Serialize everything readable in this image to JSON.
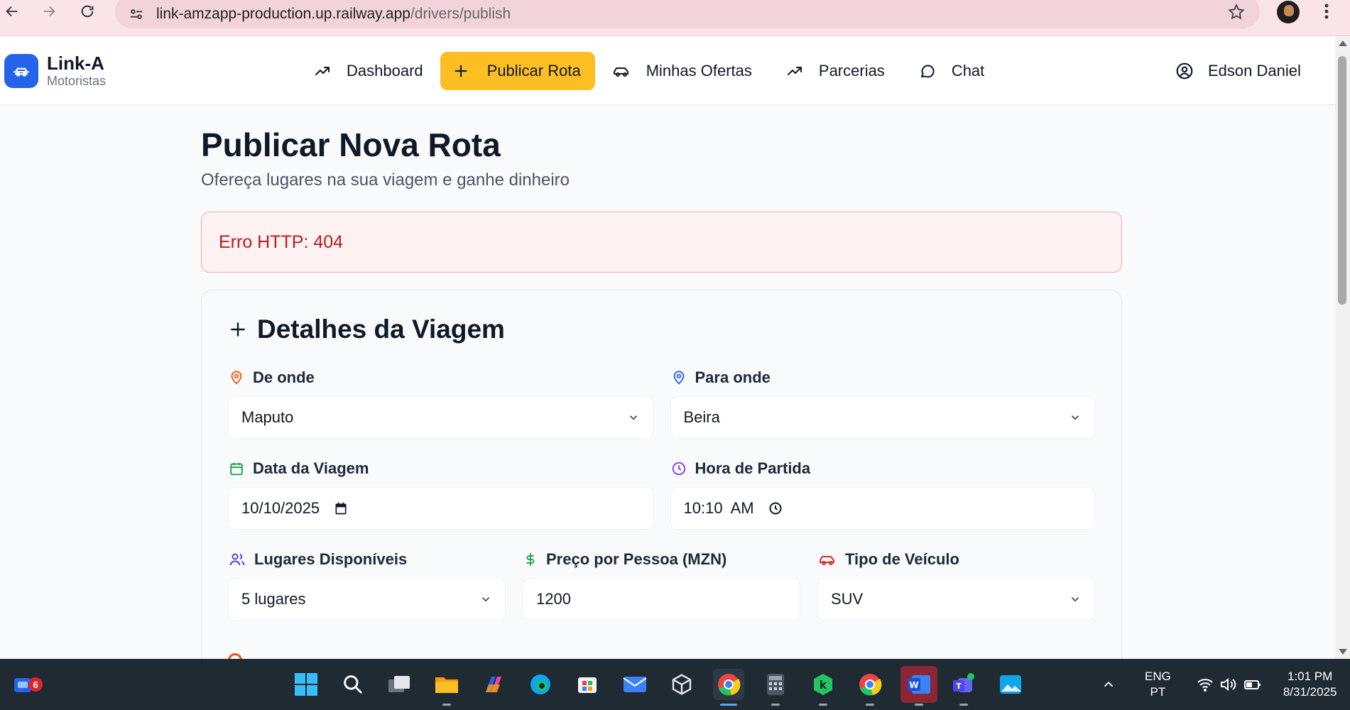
{
  "browser": {
    "url_host": "link-amzapp-production.up.railway.app",
    "url_path": "/drivers/publish"
  },
  "brand": {
    "name": "Link-A",
    "subtitle": "Motoristas"
  },
  "nav": {
    "items": [
      {
        "label": "Dashboard",
        "icon": "trending-up-icon",
        "active": false
      },
      {
        "label": "Publicar Rota",
        "icon": "plus-icon",
        "active": true
      },
      {
        "label": "Minhas Ofertas",
        "icon": "car-icon",
        "active": false
      },
      {
        "label": "Parcerias",
        "icon": "trending-up-icon",
        "active": false
      },
      {
        "label": "Chat",
        "icon": "chat-bubble-icon",
        "active": false
      }
    ]
  },
  "user": {
    "name": "Edson Daniel"
  },
  "page": {
    "title": "Publicar Nova Rota",
    "subtitle": "Ofereça lugares na sua viagem e ganhe dinheiro"
  },
  "alert": {
    "message": "Erro HTTP: 404"
  },
  "form": {
    "title": "Detalhes da Viagem",
    "from": {
      "label": "De onde",
      "value": "Maputo",
      "icon_color": "#ea580c"
    },
    "to": {
      "label": "Para onde",
      "value": "Beira",
      "icon_color": "#2563eb"
    },
    "date": {
      "label": "Data da Viagem",
      "value": "10/10/2025",
      "icon_color": "#16a34a"
    },
    "time": {
      "label": "Hora de Partida",
      "value": "10:10  AM",
      "icon_color": "#9333ea"
    },
    "seats": {
      "label": "Lugares Disponíveis",
      "value": "5 lugares",
      "icon_color": "#4f46e5"
    },
    "price": {
      "label": "Preço por Pessoa (MZN)",
      "value": "1200",
      "icon_color": "#16a34a"
    },
    "vehicle": {
      "label": "Tipo de Veículo",
      "value": "SUV",
      "icon_color": "#dc2626"
    }
  },
  "taskbar": {
    "notification_count": "6",
    "language_top": "ENG",
    "language_bottom": "PT",
    "time": "1:01 PM",
    "date": "8/31/2025"
  },
  "colors": {
    "accent": "#fbbf24",
    "brand": "#2563eb",
    "error_text": "#b91c1c",
    "error_bg": "#fef2f2"
  }
}
